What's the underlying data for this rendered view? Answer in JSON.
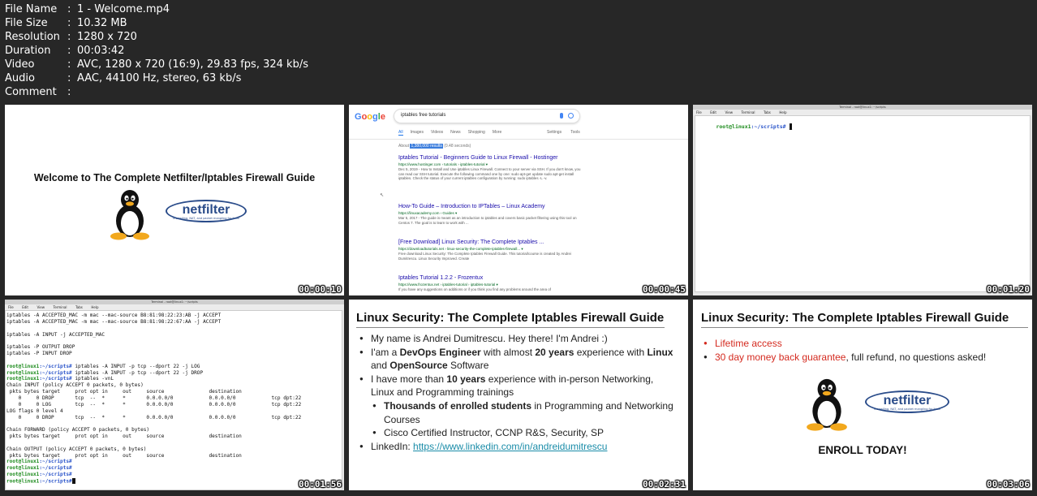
{
  "file_info": [
    {
      "key": "File Name",
      "value": "1 - Welcome.mp4"
    },
    {
      "key": "File Size",
      "value": "10.32 MB"
    },
    {
      "key": "Resolution",
      "value": "1280 x 720"
    },
    {
      "key": "Duration",
      "value": "00:03:42"
    },
    {
      "key": "Video",
      "value": "AVC, 1280 x 720 (16:9), 29.83 fps, 324 kb/s"
    },
    {
      "key": "Audio",
      "value": "AAC, 44100 Hz, stereo, 63 kb/s"
    },
    {
      "key": "Comment",
      "value": ""
    }
  ],
  "separator": ":",
  "thumbs": [
    {
      "timestamp": "00:00:10"
    },
    {
      "timestamp": "00:00:45"
    },
    {
      "timestamp": "00:01:20"
    },
    {
      "timestamp": "00:01:56"
    },
    {
      "timestamp": "00:02:31"
    },
    {
      "timestamp": "00:03:06"
    }
  ],
  "frame1": {
    "title": "Welcome to The Complete Netfilter/Iptables Firewall Guide",
    "logo_word": "netfilter",
    "logo_tagline": "firewalling, NAT, and packet mangling for linux"
  },
  "frame2": {
    "logo": "Google",
    "query": "iptables free tutorials",
    "tabs": [
      "All",
      "Images",
      "Videos",
      "News",
      "Shopping",
      "More"
    ],
    "tabs_right": [
      "Settings",
      "Tools"
    ],
    "stats_prefix": "About ",
    "stats_count": "1,380,000 results",
    "stats_suffix": " (0.48 seconds)",
    "results": [
      {
        "title": "Iptables Tutorial - Beginners Guide to Linux Firewall - Hostinger",
        "url": "https://www.hostinger.com › tutorials › iptables-tutorial ▾",
        "snippet": "Dec 5, 2019 - How to Install and Use iptables Linux Firewall. Connect to your server via SSH. If you don't know, you can read our SSH tutorial. Execute the following command one by one: sudo apt-get update sudo apt-get install iptables. Check the status of your current iptables configuration by running: sudo iptables -L -v."
      },
      {
        "title": "How-To Guide – Introduction to IPTables – Linux Academy",
        "url": "https://linuxacademy.com › Guides ▾",
        "snippet": "Mar 5, 2017 - The guide is meant as an introduction to iptables and covers basic packet filtering using this tool on Centos 7. The goal is to learn to work with ..."
      },
      {
        "title": "[Free Download] Linux Security: The Complete Iptables ...",
        "url": "https://downloadtutorials.net › linux-security-the-complete-iptables-firewall... ▾",
        "snippet": "Free download Linux Security: The Complete Iptables Firewall Guide. This tutorial/course is created by Andrei Dumitrescu. Linux Security Improved. Create"
      },
      {
        "title": "Iptables Tutorial 1.2.2 - Frozentux",
        "url": "https://www.frozentux.net › iptables-tutorial › iptables-tutorial ▾",
        "snippet": "If you have any suggestions on additions or if you think you find any problems around the area of"
      }
    ]
  },
  "frame3": {
    "window_title": "Terminal - root@linux1: ~/scripts",
    "menu": "File  Edit  View  Terminal  Tabs  Help",
    "prompt_user": "root@linux1",
    "prompt_path": ":~/scripts#"
  },
  "frame4": {
    "window_title": "Terminal - root@linux1: ~/scripts",
    "menu": "File  Edit  View  Terminal  Tabs  Help",
    "lines": [
      {
        "type": "out",
        "text": "iptables -A ACCEPTED_MAC -m mac --mac-source B8:81:98:22:23:AB -j ACCEPT"
      },
      {
        "type": "out",
        "text": "iptables -A ACCEPTED_MAC -m mac --mac-source B8:81:98:22:67:AA -j ACCEPT"
      },
      {
        "type": "out",
        "text": ""
      },
      {
        "type": "out",
        "text": "iptables -A INPUT -j ACCEPTED_MAC"
      },
      {
        "type": "out",
        "text": ""
      },
      {
        "type": "out",
        "text": "iptables -P OUTPUT DROP"
      },
      {
        "type": "out",
        "text": "iptables -P INPUT DROP"
      },
      {
        "type": "out",
        "text": ""
      },
      {
        "type": "cmd",
        "text": " iptables -A INPUT -p tcp --dport 22 -j LOG"
      },
      {
        "type": "cmd",
        "text": " iptables -A INPUT -p tcp --dport 22 -j DROP"
      },
      {
        "type": "cmd",
        "text": " iptables -vnL"
      },
      {
        "type": "out",
        "text": "Chain INPUT (policy ACCEPT 0 packets, 0 bytes)"
      },
      {
        "type": "out",
        "text": " pkts bytes target     prot opt in     out     source               destination"
      },
      {
        "type": "out",
        "text": "    0     0 DROP       tcp  --  *      *       0.0.0.0/0            0.0.0.0/0            tcp dpt:22"
      },
      {
        "type": "out",
        "text": "    0     0 LOG        tcp  --  *      *       0.0.0.0/0            0.0.0.0/0            tcp dpt:22"
      },
      {
        "type": "out",
        "text": "LOG flags 0 level 4"
      },
      {
        "type": "out",
        "text": "    0     0 DROP       tcp  --  *      *       0.0.0.0/0            0.0.0.0/0            tcp dpt:22"
      },
      {
        "type": "out",
        "text": ""
      },
      {
        "type": "out",
        "text": "Chain FORWARD (policy ACCEPT 0 packets, 0 bytes)"
      },
      {
        "type": "out",
        "text": " pkts bytes target     prot opt in     out     source               destination"
      },
      {
        "type": "out",
        "text": ""
      },
      {
        "type": "out",
        "text": "Chain OUTPUT (policy ACCEPT 0 packets, 0 bytes)"
      },
      {
        "type": "out",
        "text": " pkts bytes target     prot opt in     out     source               destination"
      },
      {
        "type": "cmd",
        "text": ""
      },
      {
        "type": "cmd",
        "text": ""
      },
      {
        "type": "cmd",
        "text": ""
      },
      {
        "type": "cmd",
        "text": ""
      }
    ],
    "prompt_user": "root@linux1",
    "prompt_path": ":~/scripts#"
  },
  "frame5": {
    "title": "Linux Security: The Complete Iptables Firewall Guide",
    "b1": "My name is Andrei Dumitrescu. Hey there! I'm Andrei :)",
    "b2_a": "I'am a ",
    "b2_b": "DevOps Engineer",
    "b2_c": " with almost ",
    "b2_d": "20 years",
    "b2_e": " experience with ",
    "b2_f": "Linux",
    "b2_g": "and ",
    "b2_h": "OpenSource",
    "b2_i": " Software",
    "b3_a": "I have more than ",
    "b3_b": "10 years",
    "b3_c": " experience with in-person Networking,",
    "b3_d": "Linux and Programming trainings",
    "s1_a": "Thousands of enrolled students",
    "s1_b": " in Programming and Networking",
    "s1_c": "Courses",
    "s2": "Cisco Certified Instructor, CCNP R&S, Security, SP",
    "b4_a": "LinkedIn: ",
    "b4_link": "https://www.linkedin.com/in/andreidumitrescu"
  },
  "frame6": {
    "title": "Linux Security: The Complete Iptables Firewall Guide",
    "b1": "Lifetime access",
    "b2_red": "30 day money back guarantee",
    "b2_rest": ", full refund, no questions asked!",
    "enroll": "ENROLL TODAY!",
    "logo_word": "netfilter",
    "logo_tagline": "firewalling, NAT, and packet mangling for linux"
  }
}
